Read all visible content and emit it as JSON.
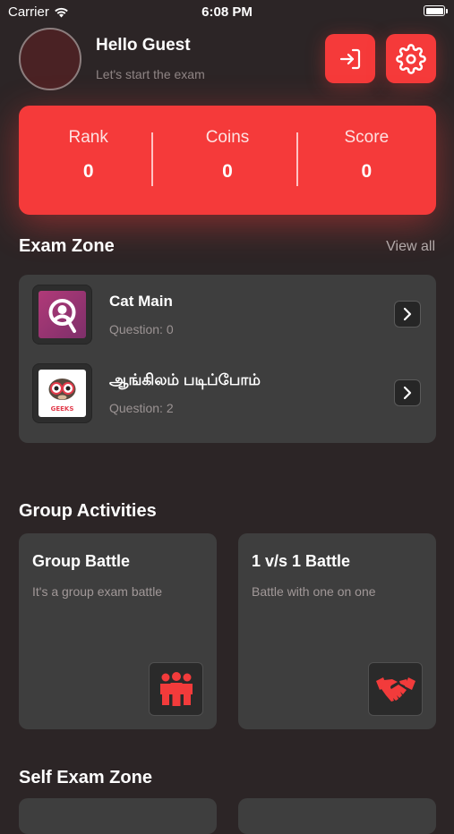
{
  "status_bar": {
    "carrier": "Carrier",
    "time": "6:08 PM"
  },
  "header": {
    "greeting": "Hello Guest",
    "subtitle": "Let's start the exam"
  },
  "stats": [
    {
      "label": "Rank",
      "value": "0"
    },
    {
      "label": "Coins",
      "value": "0"
    },
    {
      "label": "Score",
      "value": "0"
    }
  ],
  "exam_zone": {
    "title": "Exam Zone",
    "view_all": "View all",
    "items": [
      {
        "title": "Cat Main",
        "subtitle": "Question: 0",
        "thumb": "person-icon"
      },
      {
        "title": "ஆங்கிலம் படிப்போம்",
        "subtitle": "Question: 2",
        "thumb": "geeks-logo",
        "logo_text": "GEEKS"
      }
    ]
  },
  "group_activities": {
    "title": "Group Activities",
    "cards": [
      {
        "title": "Group Battle",
        "subtitle": "It's a group exam battle",
        "icon": "group-icon"
      },
      {
        "title": "1 v/s 1 Battle",
        "subtitle": "Battle with one on one",
        "icon": "handshake-icon"
      }
    ]
  },
  "self_exam_zone": {
    "title": "Self Exam Zone"
  },
  "colors": {
    "background": "#2c2526",
    "accent": "#f53a3a",
    "card": "#3e3e3e",
    "muted_text": "#8f8585"
  }
}
